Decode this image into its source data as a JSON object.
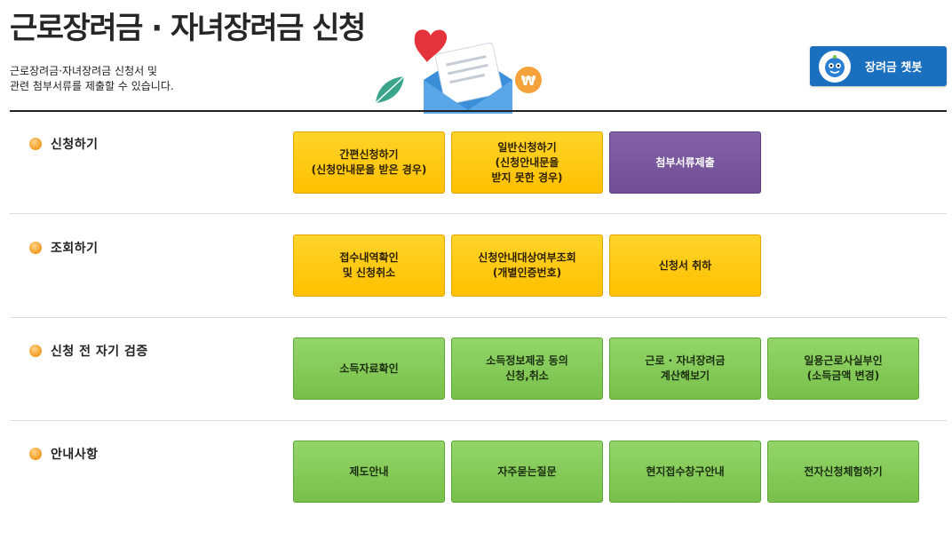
{
  "header": {
    "title": "근로장려금 · 자녀장려금 신청",
    "desc_line1": "근로장려금·자녀장려금 신청서 및",
    "desc_line2": "관련 첨부서류를 제출할 수 있습니다.",
    "chatbot_label": "장려금 챗봇"
  },
  "sections": {
    "apply": {
      "title": "신청하기",
      "buttons": [
        "간편신청하기\n(신청안내문을 받은 경우)",
        "일반신청하기\n(신청안내문을\n받지 못한 경우)",
        "첨부서류제출"
      ]
    },
    "inquiry": {
      "title": "조회하기",
      "buttons": [
        "접수내역확인\n및 신청취소",
        "신청안내대상여부조회\n(개별인증번호)",
        "신청서 취하"
      ]
    },
    "verify": {
      "title": "신청 전 자기 검증",
      "buttons": [
        "소득자료확인",
        "소득정보제공 동의\n신청,취소",
        "근로 · 자녀장려금\n계산해보기",
        "일용근로사실부인\n(소득금액 변경)"
      ]
    },
    "guide": {
      "title": "안내사항",
      "buttons": [
        "제도안내",
        "자주묻는질문",
        "현지접수창구안내",
        "전자신청체험하기"
      ]
    }
  },
  "colors": {
    "yellow": "#ffc000",
    "purple": "#6f4e94",
    "green": "#78c04a",
    "chatbot": "#1b6fbf",
    "bullet": "#f39a1e"
  },
  "icons": [
    "heart-icon",
    "envelope-icon",
    "leaf-icon",
    "won-coin-icon",
    "chatbot-mascot-icon",
    "bullet-icon"
  ]
}
